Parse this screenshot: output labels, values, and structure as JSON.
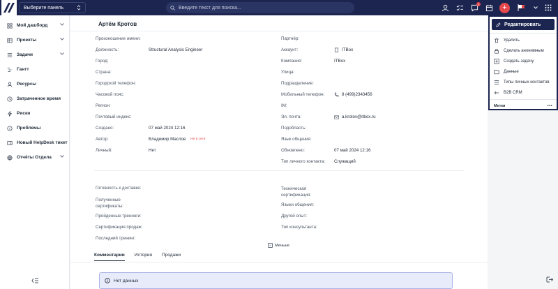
{
  "topbar": {
    "panel_select": "Выберите панель",
    "search_placeholder": "Введите текст для поиска...",
    "notification_count": "3"
  },
  "sidebar": {
    "items": [
      {
        "label": "Мой дашборд",
        "icon": "grid-icon",
        "expandable": true
      },
      {
        "label": "Проекты",
        "icon": "table-icon",
        "expandable": true
      },
      {
        "label": "Задачи",
        "icon": "list-icon",
        "expandable": true
      },
      {
        "label": "Гантт",
        "icon": "gantt-icon",
        "expandable": false
      },
      {
        "label": "Ресурсы",
        "icon": "user-icon",
        "expandable": false
      },
      {
        "label": "Затраченное время",
        "icon": "clock-icon",
        "expandable": false
      },
      {
        "label": "Риски",
        "icon": "lightning-icon",
        "expandable": false
      },
      {
        "label": "Проблемы",
        "icon": "info-icon",
        "expandable": false
      },
      {
        "label": "Новый HelpDesk тикет",
        "icon": "ticket-icon",
        "expandable": false
      },
      {
        "label": "Отчёты Отдела",
        "icon": "globe-icon",
        "expandable": true
      }
    ]
  },
  "contact": {
    "name": "Артём Кротов",
    "left_fields": [
      {
        "label": "Произношение имени:",
        "value": ""
      },
      {
        "label": "Должность:",
        "value": "Structural Analysis Engineer"
      },
      {
        "label": "Город:",
        "value": ""
      },
      {
        "label": "Страна:",
        "value": ""
      },
      {
        "label": "Городской телефон:",
        "value": ""
      },
      {
        "label": "Часовой пояс:",
        "value": ""
      },
      {
        "label": "Регион:",
        "value": ""
      },
      {
        "label": "Почтовый индекс:",
        "value": ""
      },
      {
        "label": "Создано:",
        "value": "07 май 2024 12:16"
      },
      {
        "label": "Автор:",
        "value": "Владимир Маслов"
      },
      {
        "label": "Личный:",
        "value": "Нет"
      }
    ],
    "author_status": "Не в сети",
    "right_fields": [
      {
        "label": "Партнёр:",
        "value": ""
      },
      {
        "label": "Аккаунт:",
        "value": "ITBox"
      },
      {
        "label": "Компания:",
        "value": "ITBox"
      },
      {
        "label": "Улица:",
        "value": ""
      },
      {
        "label": "Подразделение:",
        "value": ""
      },
      {
        "label": "Мобильный телефон:",
        "value": "8 (499)2343456"
      },
      {
        "label": "IM:",
        "value": ""
      },
      {
        "label": "Эл. почта:",
        "value": "a.krotov@itbox.ru"
      },
      {
        "label": "Подобласть:",
        "value": ""
      },
      {
        "label": "Язык общения:",
        "value": ""
      },
      {
        "label": "Обновлено:",
        "value": "07 май 2024 12:16"
      },
      {
        "label": "Тип личного контакта:",
        "value": "Служащий"
      }
    ],
    "left_extra": [
      {
        "label": "Готовность к доставке:"
      },
      {
        "label": "Полученные сертификаты:"
      },
      {
        "label": "Пройденные тренинги:"
      },
      {
        "label": "Сертификация продаж:"
      },
      {
        "label": "Последний тренинг:"
      }
    ],
    "right_extra": [
      {
        "label": "Техническая сертификация:"
      },
      {
        "label": "Языки общения:"
      },
      {
        "label": "Другой опыт:"
      },
      {
        "label": "Тип консультанта:"
      }
    ],
    "less_label": "Меньше"
  },
  "tabs": [
    "Комментарии",
    "История",
    "Продажи"
  ],
  "nodata": "Нет данных",
  "actions": {
    "edit": "Редактировать",
    "items": [
      {
        "label": "Удалить",
        "icon": "trash-icon"
      },
      {
        "label": "Сделать анонимным",
        "icon": "lock-icon"
      },
      {
        "label": "Создать задачу",
        "icon": "plus-square-icon"
      },
      {
        "label": "Данные",
        "icon": "folder-icon"
      },
      {
        "label": "Типы личных контактов",
        "icon": "list-icon"
      },
      {
        "label": "B2B CRM",
        "icon": "arrow-left-icon"
      }
    ],
    "tags": "Метки"
  },
  "colors": {
    "brand": "#1b2550",
    "accent": "#e5484d"
  }
}
